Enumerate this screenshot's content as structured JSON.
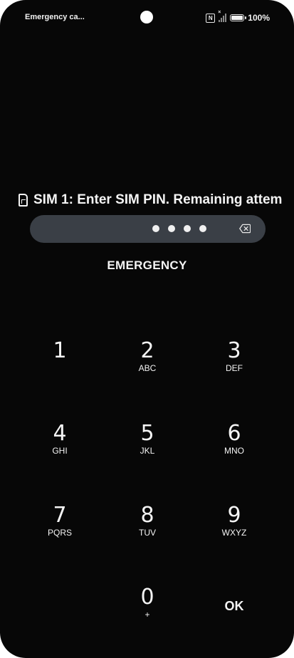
{
  "status_bar": {
    "notification_text": "Emergency ca...",
    "battery_percent": "100%",
    "icons": [
      "nfc-icon",
      "signal-no-sim-icon",
      "battery-icon"
    ]
  },
  "sim_prompt": {
    "icon": "sim-card-icon",
    "text": "SIM 1: Enter SIM PIN. Remaining attem"
  },
  "pin_field": {
    "entered_digits_count": 4,
    "clear_icon": "backspace-icon"
  },
  "emergency_label": "EMERGENCY",
  "keypad": {
    "keys": [
      {
        "digit": "1",
        "letters": ""
      },
      {
        "digit": "2",
        "letters": "ABC"
      },
      {
        "digit": "3",
        "letters": "DEF"
      },
      {
        "digit": "4",
        "letters": "GHI"
      },
      {
        "digit": "5",
        "letters": "JKL"
      },
      {
        "digit": "6",
        "letters": "MNO"
      },
      {
        "digit": "7",
        "letters": "PQRS"
      },
      {
        "digit": "8",
        "letters": "TUV"
      },
      {
        "digit": "9",
        "letters": "WXYZ"
      },
      {
        "digit": "0",
        "letters": "+"
      }
    ],
    "ok_label": "OK"
  }
}
